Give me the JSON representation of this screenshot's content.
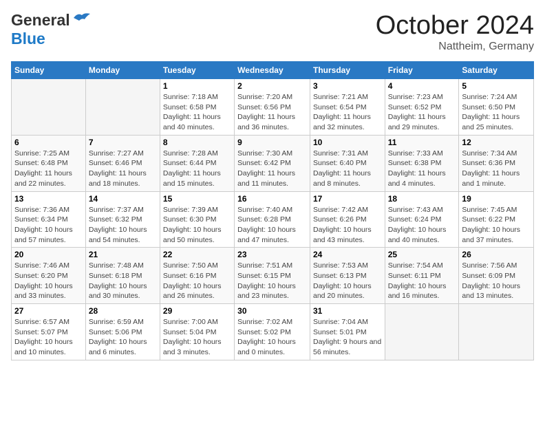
{
  "header": {
    "logo_line1": "General",
    "logo_line2": "Blue",
    "month": "October 2024",
    "location": "Nattheim, Germany"
  },
  "weekdays": [
    "Sunday",
    "Monday",
    "Tuesday",
    "Wednesday",
    "Thursday",
    "Friday",
    "Saturday"
  ],
  "weeks": [
    [
      {
        "day": "",
        "info": ""
      },
      {
        "day": "",
        "info": ""
      },
      {
        "day": "1",
        "info": "Sunrise: 7:18 AM\nSunset: 6:58 PM\nDaylight: 11 hours and 40 minutes."
      },
      {
        "day": "2",
        "info": "Sunrise: 7:20 AM\nSunset: 6:56 PM\nDaylight: 11 hours and 36 minutes."
      },
      {
        "day": "3",
        "info": "Sunrise: 7:21 AM\nSunset: 6:54 PM\nDaylight: 11 hours and 32 minutes."
      },
      {
        "day": "4",
        "info": "Sunrise: 7:23 AM\nSunset: 6:52 PM\nDaylight: 11 hours and 29 minutes."
      },
      {
        "day": "5",
        "info": "Sunrise: 7:24 AM\nSunset: 6:50 PM\nDaylight: 11 hours and 25 minutes."
      }
    ],
    [
      {
        "day": "6",
        "info": "Sunrise: 7:25 AM\nSunset: 6:48 PM\nDaylight: 11 hours and 22 minutes."
      },
      {
        "day": "7",
        "info": "Sunrise: 7:27 AM\nSunset: 6:46 PM\nDaylight: 11 hours and 18 minutes."
      },
      {
        "day": "8",
        "info": "Sunrise: 7:28 AM\nSunset: 6:44 PM\nDaylight: 11 hours and 15 minutes."
      },
      {
        "day": "9",
        "info": "Sunrise: 7:30 AM\nSunset: 6:42 PM\nDaylight: 11 hours and 11 minutes."
      },
      {
        "day": "10",
        "info": "Sunrise: 7:31 AM\nSunset: 6:40 PM\nDaylight: 11 hours and 8 minutes."
      },
      {
        "day": "11",
        "info": "Sunrise: 7:33 AM\nSunset: 6:38 PM\nDaylight: 11 hours and 4 minutes."
      },
      {
        "day": "12",
        "info": "Sunrise: 7:34 AM\nSunset: 6:36 PM\nDaylight: 11 hours and 1 minute."
      }
    ],
    [
      {
        "day": "13",
        "info": "Sunrise: 7:36 AM\nSunset: 6:34 PM\nDaylight: 10 hours and 57 minutes."
      },
      {
        "day": "14",
        "info": "Sunrise: 7:37 AM\nSunset: 6:32 PM\nDaylight: 10 hours and 54 minutes."
      },
      {
        "day": "15",
        "info": "Sunrise: 7:39 AM\nSunset: 6:30 PM\nDaylight: 10 hours and 50 minutes."
      },
      {
        "day": "16",
        "info": "Sunrise: 7:40 AM\nSunset: 6:28 PM\nDaylight: 10 hours and 47 minutes."
      },
      {
        "day": "17",
        "info": "Sunrise: 7:42 AM\nSunset: 6:26 PM\nDaylight: 10 hours and 43 minutes."
      },
      {
        "day": "18",
        "info": "Sunrise: 7:43 AM\nSunset: 6:24 PM\nDaylight: 10 hours and 40 minutes."
      },
      {
        "day": "19",
        "info": "Sunrise: 7:45 AM\nSunset: 6:22 PM\nDaylight: 10 hours and 37 minutes."
      }
    ],
    [
      {
        "day": "20",
        "info": "Sunrise: 7:46 AM\nSunset: 6:20 PM\nDaylight: 10 hours and 33 minutes."
      },
      {
        "day": "21",
        "info": "Sunrise: 7:48 AM\nSunset: 6:18 PM\nDaylight: 10 hours and 30 minutes."
      },
      {
        "day": "22",
        "info": "Sunrise: 7:50 AM\nSunset: 6:16 PM\nDaylight: 10 hours and 26 minutes."
      },
      {
        "day": "23",
        "info": "Sunrise: 7:51 AM\nSunset: 6:15 PM\nDaylight: 10 hours and 23 minutes."
      },
      {
        "day": "24",
        "info": "Sunrise: 7:53 AM\nSunset: 6:13 PM\nDaylight: 10 hours and 20 minutes."
      },
      {
        "day": "25",
        "info": "Sunrise: 7:54 AM\nSunset: 6:11 PM\nDaylight: 10 hours and 16 minutes."
      },
      {
        "day": "26",
        "info": "Sunrise: 7:56 AM\nSunset: 6:09 PM\nDaylight: 10 hours and 13 minutes."
      }
    ],
    [
      {
        "day": "27",
        "info": "Sunrise: 6:57 AM\nSunset: 5:07 PM\nDaylight: 10 hours and 10 minutes."
      },
      {
        "day": "28",
        "info": "Sunrise: 6:59 AM\nSunset: 5:06 PM\nDaylight: 10 hours and 6 minutes."
      },
      {
        "day": "29",
        "info": "Sunrise: 7:00 AM\nSunset: 5:04 PM\nDaylight: 10 hours and 3 minutes."
      },
      {
        "day": "30",
        "info": "Sunrise: 7:02 AM\nSunset: 5:02 PM\nDaylight: 10 hours and 0 minutes."
      },
      {
        "day": "31",
        "info": "Sunrise: 7:04 AM\nSunset: 5:01 PM\nDaylight: 9 hours and 56 minutes."
      },
      {
        "day": "",
        "info": ""
      },
      {
        "day": "",
        "info": ""
      }
    ]
  ]
}
